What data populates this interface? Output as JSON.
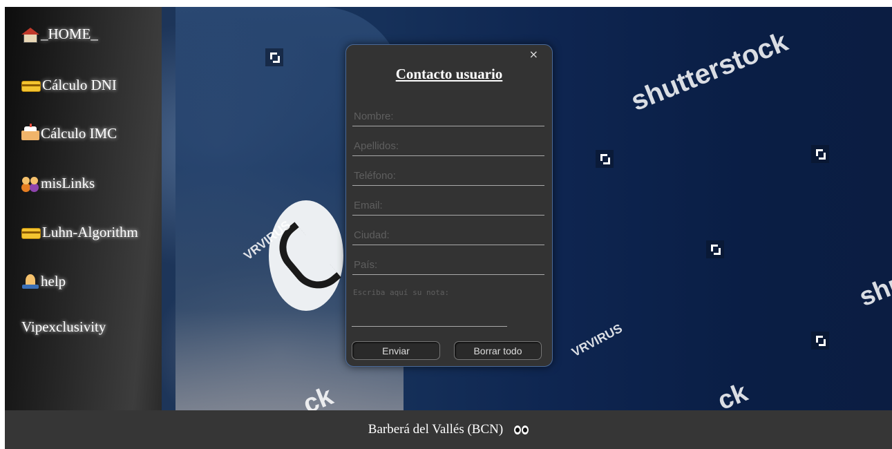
{
  "sidebar": {
    "items": [
      {
        "icon": "house-icon",
        "label": "_HOME_"
      },
      {
        "icon": "credit-card-icon",
        "label": "Cálculo DNI"
      },
      {
        "icon": "cake-icon",
        "label": "Cálculo IMC"
      },
      {
        "icon": "family-icon",
        "label": "misLinks"
      },
      {
        "icon": "credit-card-icon",
        "label": "Luhn-Algorithm"
      },
      {
        "icon": "praying-hands-icon",
        "label": "help"
      },
      {
        "icon": "",
        "label": "Vipexclusivity"
      }
    ]
  },
  "hero": {
    "watermarks": [
      "shutterstock",
      "VRVIRUS",
      "VRVIRUS",
      "shut",
      "ck",
      "ck"
    ]
  },
  "modal": {
    "close": "×",
    "title": "Contacto usuario",
    "fields": {
      "nombre": "Nombre:",
      "apellidos": "Apellidos:",
      "telefono": "Teléfono:",
      "email": "Email:",
      "ciudad": "Ciudad:",
      "pais": "País:"
    },
    "note_placeholder": "Escriba aquí su nota:",
    "send": "Enviar",
    "clear": "Borrar todo"
  },
  "footer": {
    "location": "Barberá del Vallés (BCN)",
    "icon": "eyes-icon"
  }
}
